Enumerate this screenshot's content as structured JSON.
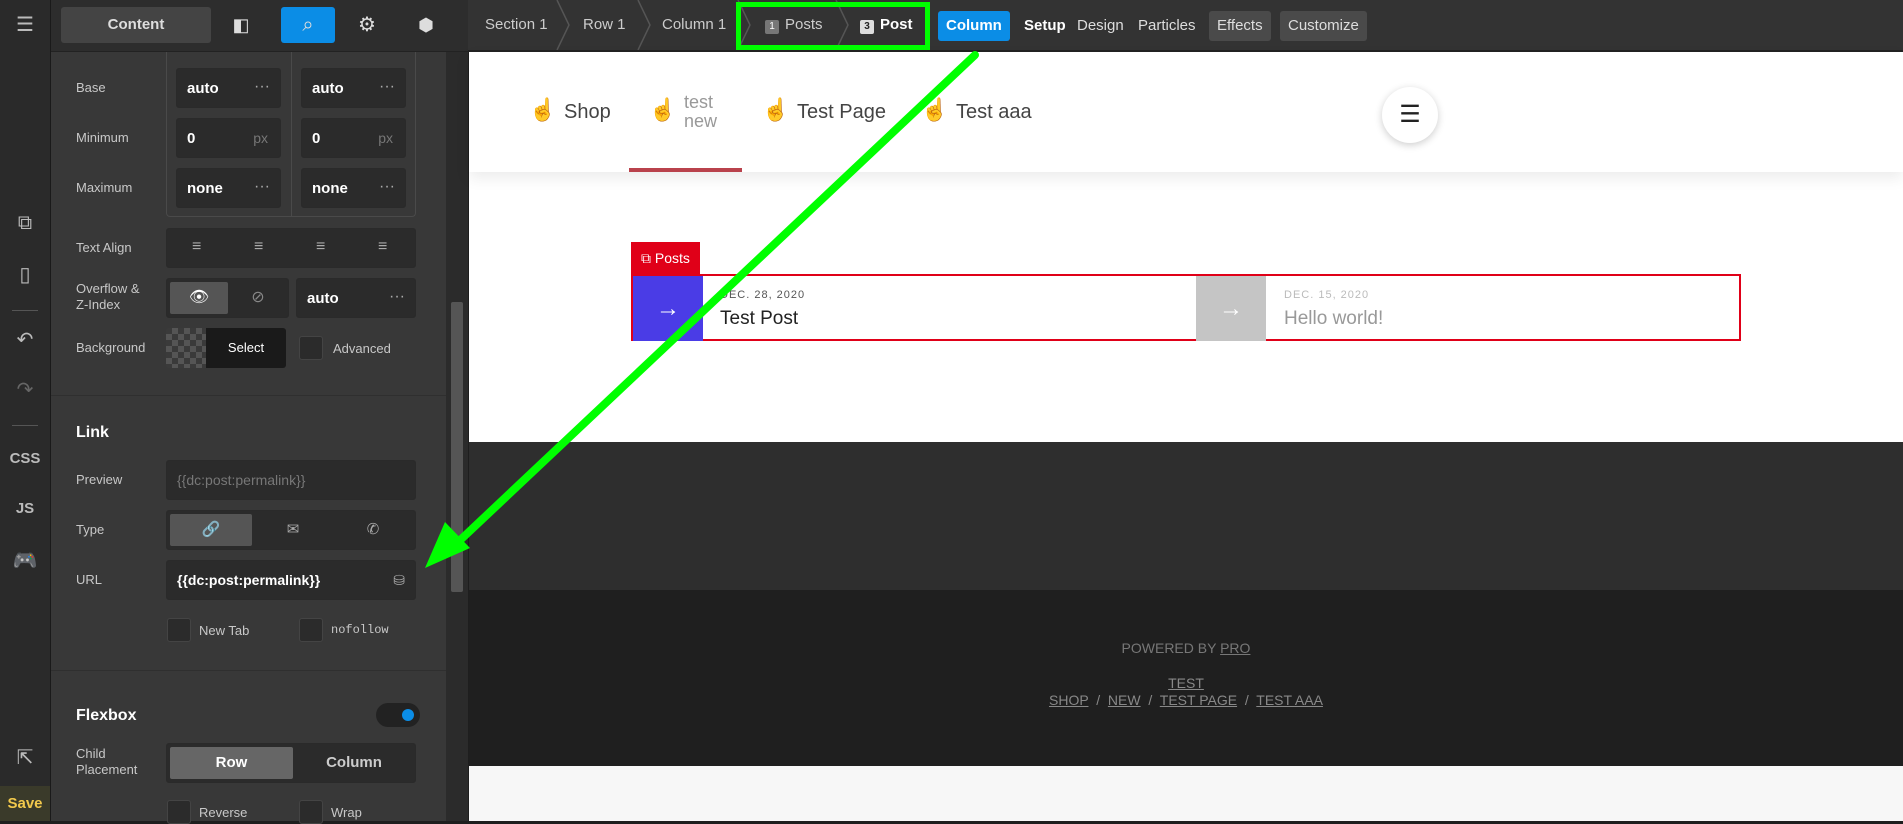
{
  "rail": {
    "icons": [
      "menu-icon",
      "add-element-icon",
      "responsive-icon",
      "undo-icon",
      "redo-icon"
    ],
    "css_label": "CSS",
    "js_label": "JS",
    "save_label": "Save"
  },
  "panel_toolbar": {
    "content_label": "Content"
  },
  "fields": {
    "base_label": "Base",
    "base_left": "auto",
    "base_right": "auto",
    "min_label": "Minimum",
    "min_left": "0",
    "min_right": "0",
    "unit": "px",
    "max_label": "Maximum",
    "max_left": "none",
    "max_right": "none",
    "text_align_label": "Text Align",
    "overflow_label": "Overflow &\nZ-Index",
    "overflow_value": "auto",
    "background_label": "Background",
    "background_select": "Select",
    "advanced_label": "Advanced",
    "link_section": "Link",
    "preview_label": "Preview",
    "preview_placeholder": "{{dc:post:permalink}}",
    "type_label": "Type",
    "url_label": "URL",
    "url_value": "{{dc:post:permalink}}",
    "new_tab_label": "New Tab",
    "nofollow_label": "nofollow",
    "flexbox_section": "Flexbox",
    "child_placement_label": "Child\nPlacement",
    "row_label": "Row",
    "column_label": "Column",
    "reverse_label": "Reverse",
    "wrap_label": "Wrap"
  },
  "breadcrumbs": [
    {
      "label": "Section 1"
    },
    {
      "label": "Row 1"
    },
    {
      "label": "Column 1"
    },
    {
      "num": "1",
      "label": "Posts"
    },
    {
      "num": "3",
      "label": "Post"
    }
  ],
  "tabs": [
    "Column",
    "Setup",
    "Design",
    "Particles",
    "Effects",
    "Customize"
  ],
  "site_nav": [
    "Shop",
    "test\nnew",
    "Test Page",
    "Test aaa"
  ],
  "posts_tag": "Posts",
  "posts": [
    {
      "date": "DEC. 28, 2020",
      "title": "Test Post"
    },
    {
      "date": "DEC. 15, 2020",
      "title": "Hello world!"
    }
  ],
  "footer": {
    "powered": "POWERED BY",
    "powered_link": "PRO",
    "test_link": "TEST",
    "links": [
      "SHOP",
      "NEW",
      "TEST PAGE",
      "TEST AAA"
    ]
  },
  "colors": {
    "accent": "#0b8de6",
    "highlight": "#00ff00",
    "post_arrow": "#4a3ce6",
    "posts_red": "#e00018"
  }
}
